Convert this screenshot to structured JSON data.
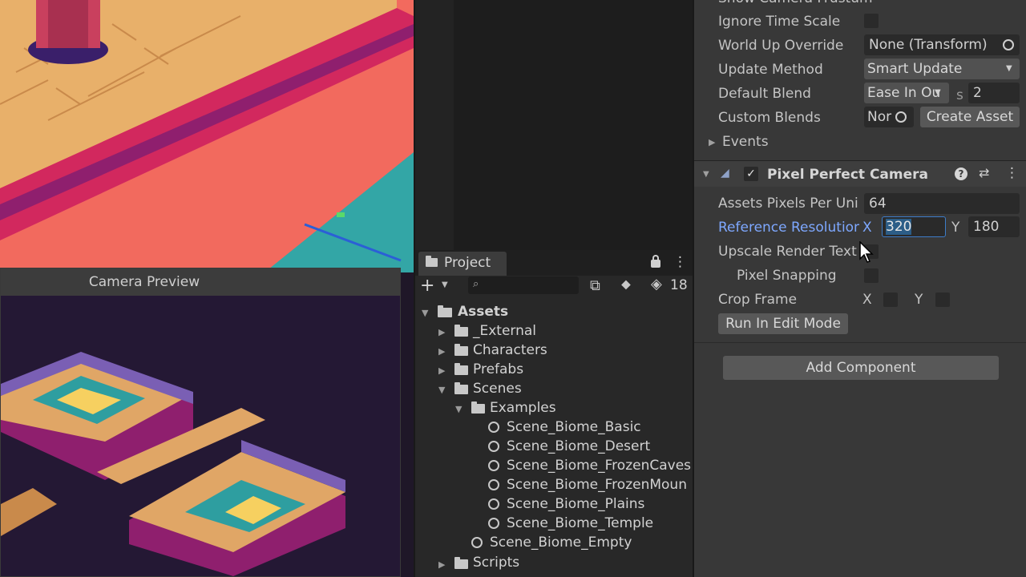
{
  "camera_preview": {
    "title": "Camera Preview"
  },
  "project": {
    "tab_label": "Project",
    "search_placeholder": "",
    "hidden_count": "18",
    "tree": {
      "assets": "Assets",
      "external": "_External",
      "characters": "Characters",
      "prefabs": "Prefabs",
      "scenes": "Scenes",
      "examples": "Examples",
      "scene_basic": "Scene_Biome_Basic",
      "scene_desert": "Scene_Biome_Desert",
      "scene_frozencaves": "Scene_Biome_FrozenCaves",
      "scene_frozenmount": "Scene_Biome_FrozenMoun",
      "scene_plains": "Scene_Biome_Plains",
      "scene_temple": "Scene_Biome_Temple",
      "scene_empty": "Scene_Biome_Empty",
      "scripts": "Scripts"
    }
  },
  "inspector": {
    "cut_top_label": "Show Camera Frustum",
    "ignore_time_scale": "Ignore Time Scale",
    "world_up_override": "World Up Override",
    "world_up_value": "None (Transform)",
    "update_method": "Update Method",
    "update_method_value": "Smart Update",
    "default_blend": "Default Blend",
    "default_blend_value": "Ease In Ou",
    "default_blend_s": "s",
    "default_blend_time": "2",
    "custom_blends": "Custom Blends",
    "custom_blends_value": "Nor",
    "create_asset": "Create Asset",
    "events": "Events",
    "component_title": "Pixel Perfect Camera",
    "assets_ppu_label": "Assets Pixels Per Uni",
    "assets_ppu_value": "64",
    "ref_res_label": "Reference Resolution",
    "ref_res_x_label": "X",
    "ref_res_x_value": "320",
    "ref_res_y_label": "Y",
    "ref_res_y_value": "180",
    "upscale_rt_label": "Upscale Render Text",
    "pixel_snapping_label": "Pixel Snapping",
    "crop_frame_label": "Crop Frame",
    "crop_x_label": "X",
    "crop_y_label": "Y",
    "run_in_edit_mode": "Run In Edit Mode",
    "add_component": "Add Component"
  },
  "colors": {
    "accent_blue": "#7ea8ff",
    "selection": "#2c5d87",
    "inspector_bg": "#383838"
  }
}
